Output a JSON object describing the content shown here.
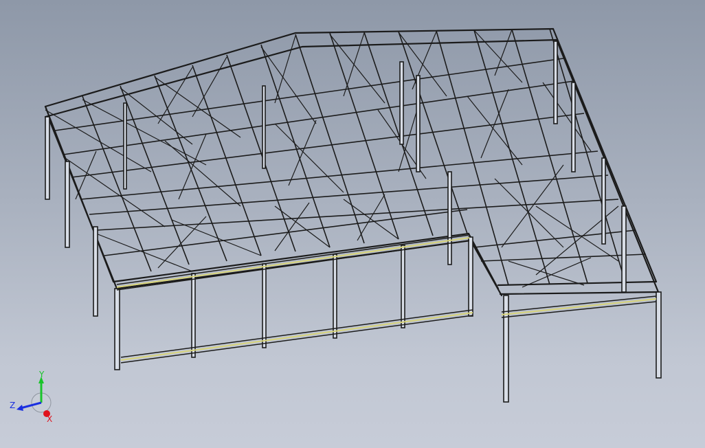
{
  "viewport": {
    "view_type": "isometric",
    "background_top": "#8e98a8",
    "background_bottom": "#c7ccd8"
  },
  "model": {
    "description_name": "steel-space-frame-structure",
    "line_color": "#1b1b1b",
    "highlight_color": "#d8d47a"
  },
  "triad": {
    "x_label": "X",
    "y_label": "Y",
    "z_label": "Z",
    "x_color": "#e0131d",
    "y_color": "#19c42a",
    "z_color": "#1a2fe0"
  }
}
